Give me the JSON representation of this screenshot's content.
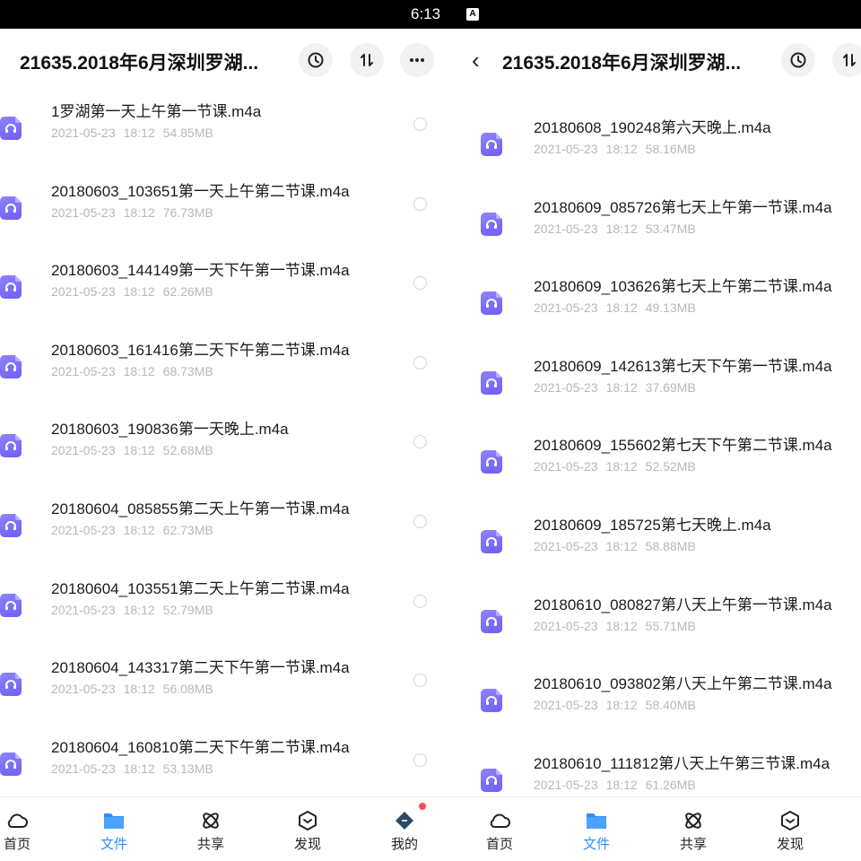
{
  "statusbar": {
    "time": "6:13"
  },
  "folder": {
    "title": "21635.2018年6月深圳罗湖..."
  },
  "tabs": {
    "home": "首页",
    "files": "文件",
    "share": "共享",
    "discover": "发现",
    "mine": "我的"
  },
  "left_files": [
    {
      "name": "1罗湖第一天上午第一节课.m4a",
      "date": "2021-05-23",
      "time": "18:12",
      "size": "54.85MB"
    },
    {
      "name": "20180603_103651第一天上午第二节课.m4a",
      "date": "2021-05-23",
      "time": "18:12",
      "size": "76.73MB"
    },
    {
      "name": "20180603_144149第一天下午第一节课.m4a",
      "date": "2021-05-23",
      "time": "18:12",
      "size": "62.26MB"
    },
    {
      "name": "20180603_161416第二天下午第二节课.m4a",
      "date": "2021-05-23",
      "time": "18:12",
      "size": "68.73MB"
    },
    {
      "name": "20180603_190836第一天晚上.m4a",
      "date": "2021-05-23",
      "time": "18:12",
      "size": "52.68MB"
    },
    {
      "name": "20180604_085855第二天上午第一节课.m4a",
      "date": "2021-05-23",
      "time": "18:12",
      "size": "62.73MB"
    },
    {
      "name": "20180604_103551第二天上午第二节课.m4a",
      "date": "2021-05-23",
      "time": "18:12",
      "size": "52.79MB"
    },
    {
      "name": "20180604_143317第二天下午第一节课.m4a",
      "date": "2021-05-23",
      "time": "18:12",
      "size": "56.08MB"
    },
    {
      "name": "20180604_160810第二天下午第二节课.m4a",
      "date": "2021-05-23",
      "time": "18:12",
      "size": "53.13MB"
    }
  ],
  "right_files": [
    {
      "name": "20180608_190248第六天晚上.m4a",
      "date": "2021-05-23",
      "time": "18:12",
      "size": "58.16MB"
    },
    {
      "name": "20180609_085726第七天上午第一节课.m4a",
      "date": "2021-05-23",
      "time": "18:12",
      "size": "53.47MB"
    },
    {
      "name": "20180609_103626第七天上午第二节课.m4a",
      "date": "2021-05-23",
      "time": "18:12",
      "size": "49.13MB"
    },
    {
      "name": "20180609_142613第七天下午第一节课.m4a",
      "date": "2021-05-23",
      "time": "18:12",
      "size": "37.69MB"
    },
    {
      "name": "20180609_155602第七天下午第二节课.m4a",
      "date": "2021-05-23",
      "time": "18:12",
      "size": "52.52MB"
    },
    {
      "name": "20180609_185725第七天晚上.m4a",
      "date": "2021-05-23",
      "time": "18:12",
      "size": "58.88MB"
    },
    {
      "name": "20180610_080827第八天上午第一节课.m4a",
      "date": "2021-05-23",
      "time": "18:12",
      "size": "55.71MB"
    },
    {
      "name": "20180610_093802第八天上午第二节课.m4a",
      "date": "2021-05-23",
      "time": "18:12",
      "size": "58.40MB"
    },
    {
      "name": "20180610_111812第八天上午第三节课.m4a",
      "date": "2021-05-23",
      "time": "18:12",
      "size": "61.26MB"
    }
  ],
  "colors": {
    "accent": "#2f8cff",
    "file_icon": "#7b6ff7",
    "badge": "#ff4d4f"
  },
  "icons": {
    "header": [
      "back-icon",
      "history-icon",
      "sort-icon",
      "more-icon"
    ],
    "file": "audio-file-icon",
    "tabs": [
      "cloud-icon",
      "folder-icon",
      "share-atom-icon",
      "compass-icon",
      "diamond-icon"
    ]
  }
}
